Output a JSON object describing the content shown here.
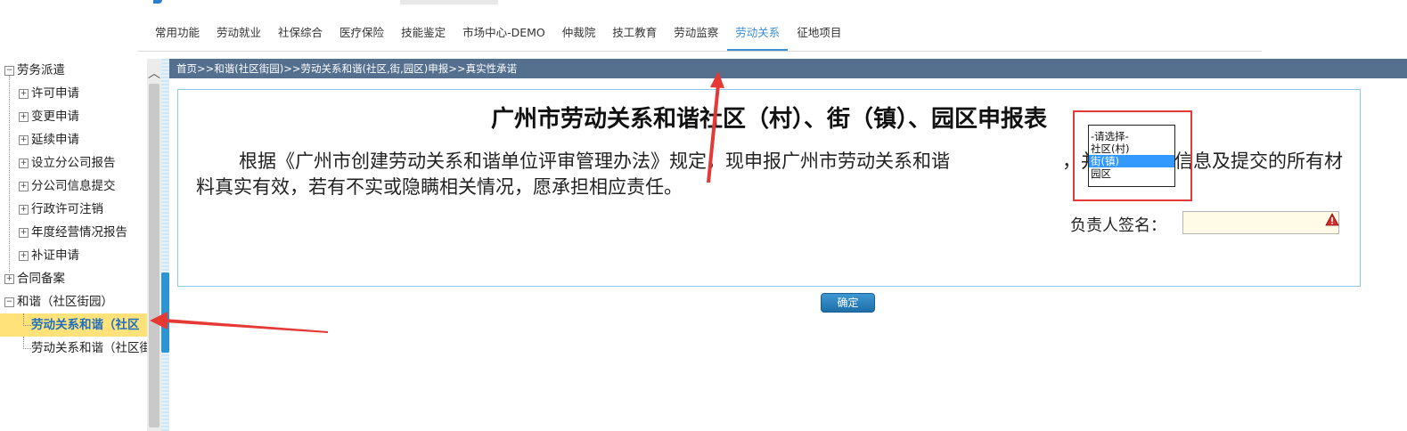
{
  "nav": {
    "items": [
      "常用功能",
      "劳动就业",
      "社保综合",
      "医疗保险",
      "技能鉴定",
      "市场中心-DEMO",
      "仲裁院",
      "技工教育",
      "劳动监察",
      "劳动关系",
      "征地项目"
    ],
    "active_index": 9
  },
  "sidebar": {
    "items": [
      {
        "label": "劳务派遣",
        "expander": "⊟"
      },
      {
        "label": "许可申请",
        "expander": "⊞"
      },
      {
        "label": "变更申请",
        "expander": "⊞"
      },
      {
        "label": "延续申请",
        "expander": "⊞"
      },
      {
        "label": "设立分公司报告",
        "expander": "⊞"
      },
      {
        "label": "分公司信息提交",
        "expander": "⊞"
      },
      {
        "label": "行政许可注销",
        "expander": "⊞"
      },
      {
        "label": "年度经营情况报告",
        "expander": "⊞"
      },
      {
        "label": "补证申请",
        "expander": "⊞"
      },
      {
        "label": "合同备案",
        "expander": "⊞"
      },
      {
        "label": "和谐（社区街园）",
        "expander": "⊟"
      },
      {
        "label": "劳动关系和谐（社区"
      },
      {
        "label": "劳动关系和谐（社区街"
      }
    ],
    "scroll_up": "︿"
  },
  "breadcrumb": "首页>>和谐(社区街园)>>劳动关系和谐(社区,街,园区)申报>>真实性承诺",
  "form": {
    "title": "广州市劳动关系和谐社区（村）、街（镇）、园区申报表",
    "body_before": "根据《广州市创建劳动关系和谐单位评审管理办法》规定，现申报广州市劳动关系和谐",
    "body_after": "，并承诺以下信息及提交的所有材料真实有效，若有不实或隐瞒相关情况，愿承担相应责任。",
    "signature_label": "负责人签名：",
    "signature_value": "",
    "dropdown_options": [
      "-请选择-",
      "社区(村)",
      "街(镇)",
      "园区"
    ],
    "dropdown_highlight": 2
  },
  "buttons": {
    "confirm": "确定"
  },
  "colors": {
    "accent": "#3a8fd6",
    "breadcrumb_bg": "#556f8f",
    "annotation": "#e53935",
    "selected_bg": "#ffe27a"
  }
}
